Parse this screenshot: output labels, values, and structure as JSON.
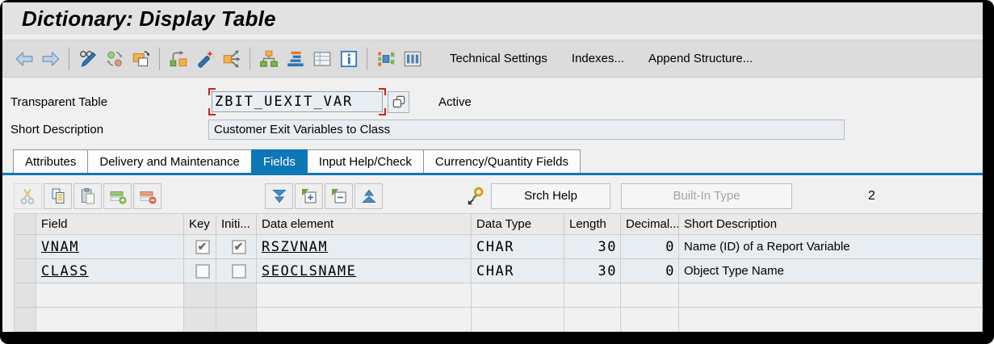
{
  "window": {
    "title": "Dictionary: Display Table"
  },
  "toolbar": {
    "buttons": [
      "Technical Settings",
      "Indexes...",
      "Append Structure..."
    ]
  },
  "form": {
    "table_label": "Transparent Table",
    "table_name": "ZBIT_UEXIT_VAR",
    "status": "Active",
    "desc_label": "Short Description",
    "desc_value": "Customer Exit Variables to Class"
  },
  "tabs": {
    "active": "Fields",
    "items": [
      "Attributes",
      "Delivery and Maintenance",
      "Fields",
      "Input Help/Check",
      "Currency/Quantity Fields"
    ]
  },
  "grid": {
    "toolbar": {
      "srch_help": "Srch Help",
      "built_in_type": "Built-In Type",
      "count": "2"
    },
    "columns": [
      "Field",
      "Key",
      "Initi...",
      "Data element",
      "Data Type",
      "Length",
      "Decimal...",
      "Short Description"
    ],
    "rows": [
      {
        "field": "VNAM",
        "key_mark": "✔",
        "initial_mark": "✔",
        "data_element": "RSZVNAM",
        "data_type": "CHAR",
        "length": "30",
        "decimals": "0",
        "short_description": "Name (ID) of a Report Variable"
      },
      {
        "field": "CLASS",
        "key_mark": "",
        "initial_mark": "",
        "data_element": "SEOCLSNAME",
        "data_type": "CHAR",
        "length": "30",
        "decimals": "0",
        "short_description": "Object Type Name"
      }
    ]
  },
  "colors": {
    "accent_blue": "#0e77b8",
    "focus_red": "#cf2121",
    "row_blue": "#e8edf1",
    "toolbar_gray": "#dcdcdc",
    "content_gray": "#f0f0f0"
  },
  "icons": {
    "back-icon": "blue-left-arrow",
    "forward-icon": "blue-right-arrow",
    "display-change-icon": "glasses-pencil",
    "refresh-icon": "two-circles-arrows",
    "copy-object-icon": "overlapping-squares-rotate",
    "goto-icon": "squares-jump-arrow",
    "wand-icon": "magic-wand-spark",
    "where-used-icon": "square-spread-arrows",
    "hierarchy-icon": "org-boxes",
    "sort-stack-icon": "stacked-bars",
    "table-icon": "grid-table",
    "info-icon": "boxed-i",
    "graphic-icon": "colored-boxes",
    "columns-icon": "three-columns",
    "cut-icon": "scissors",
    "copy-row-icon": "two-documents",
    "paste-icon": "clipboard",
    "insert-row-icon": "green-row-plus",
    "delete-row-icon": "red-row-minus",
    "move-down-icon": "double-triangle-down",
    "expand-icon": "box-plus-green-corner",
    "collapse-icon": "box-minus-green-corner",
    "move-up-icon": "double-triangle-up",
    "search-help-key-icon": "orange-key-arrow",
    "copy-field-icon": "overlapping-squares",
    "checkbox-checked": "✔"
  }
}
